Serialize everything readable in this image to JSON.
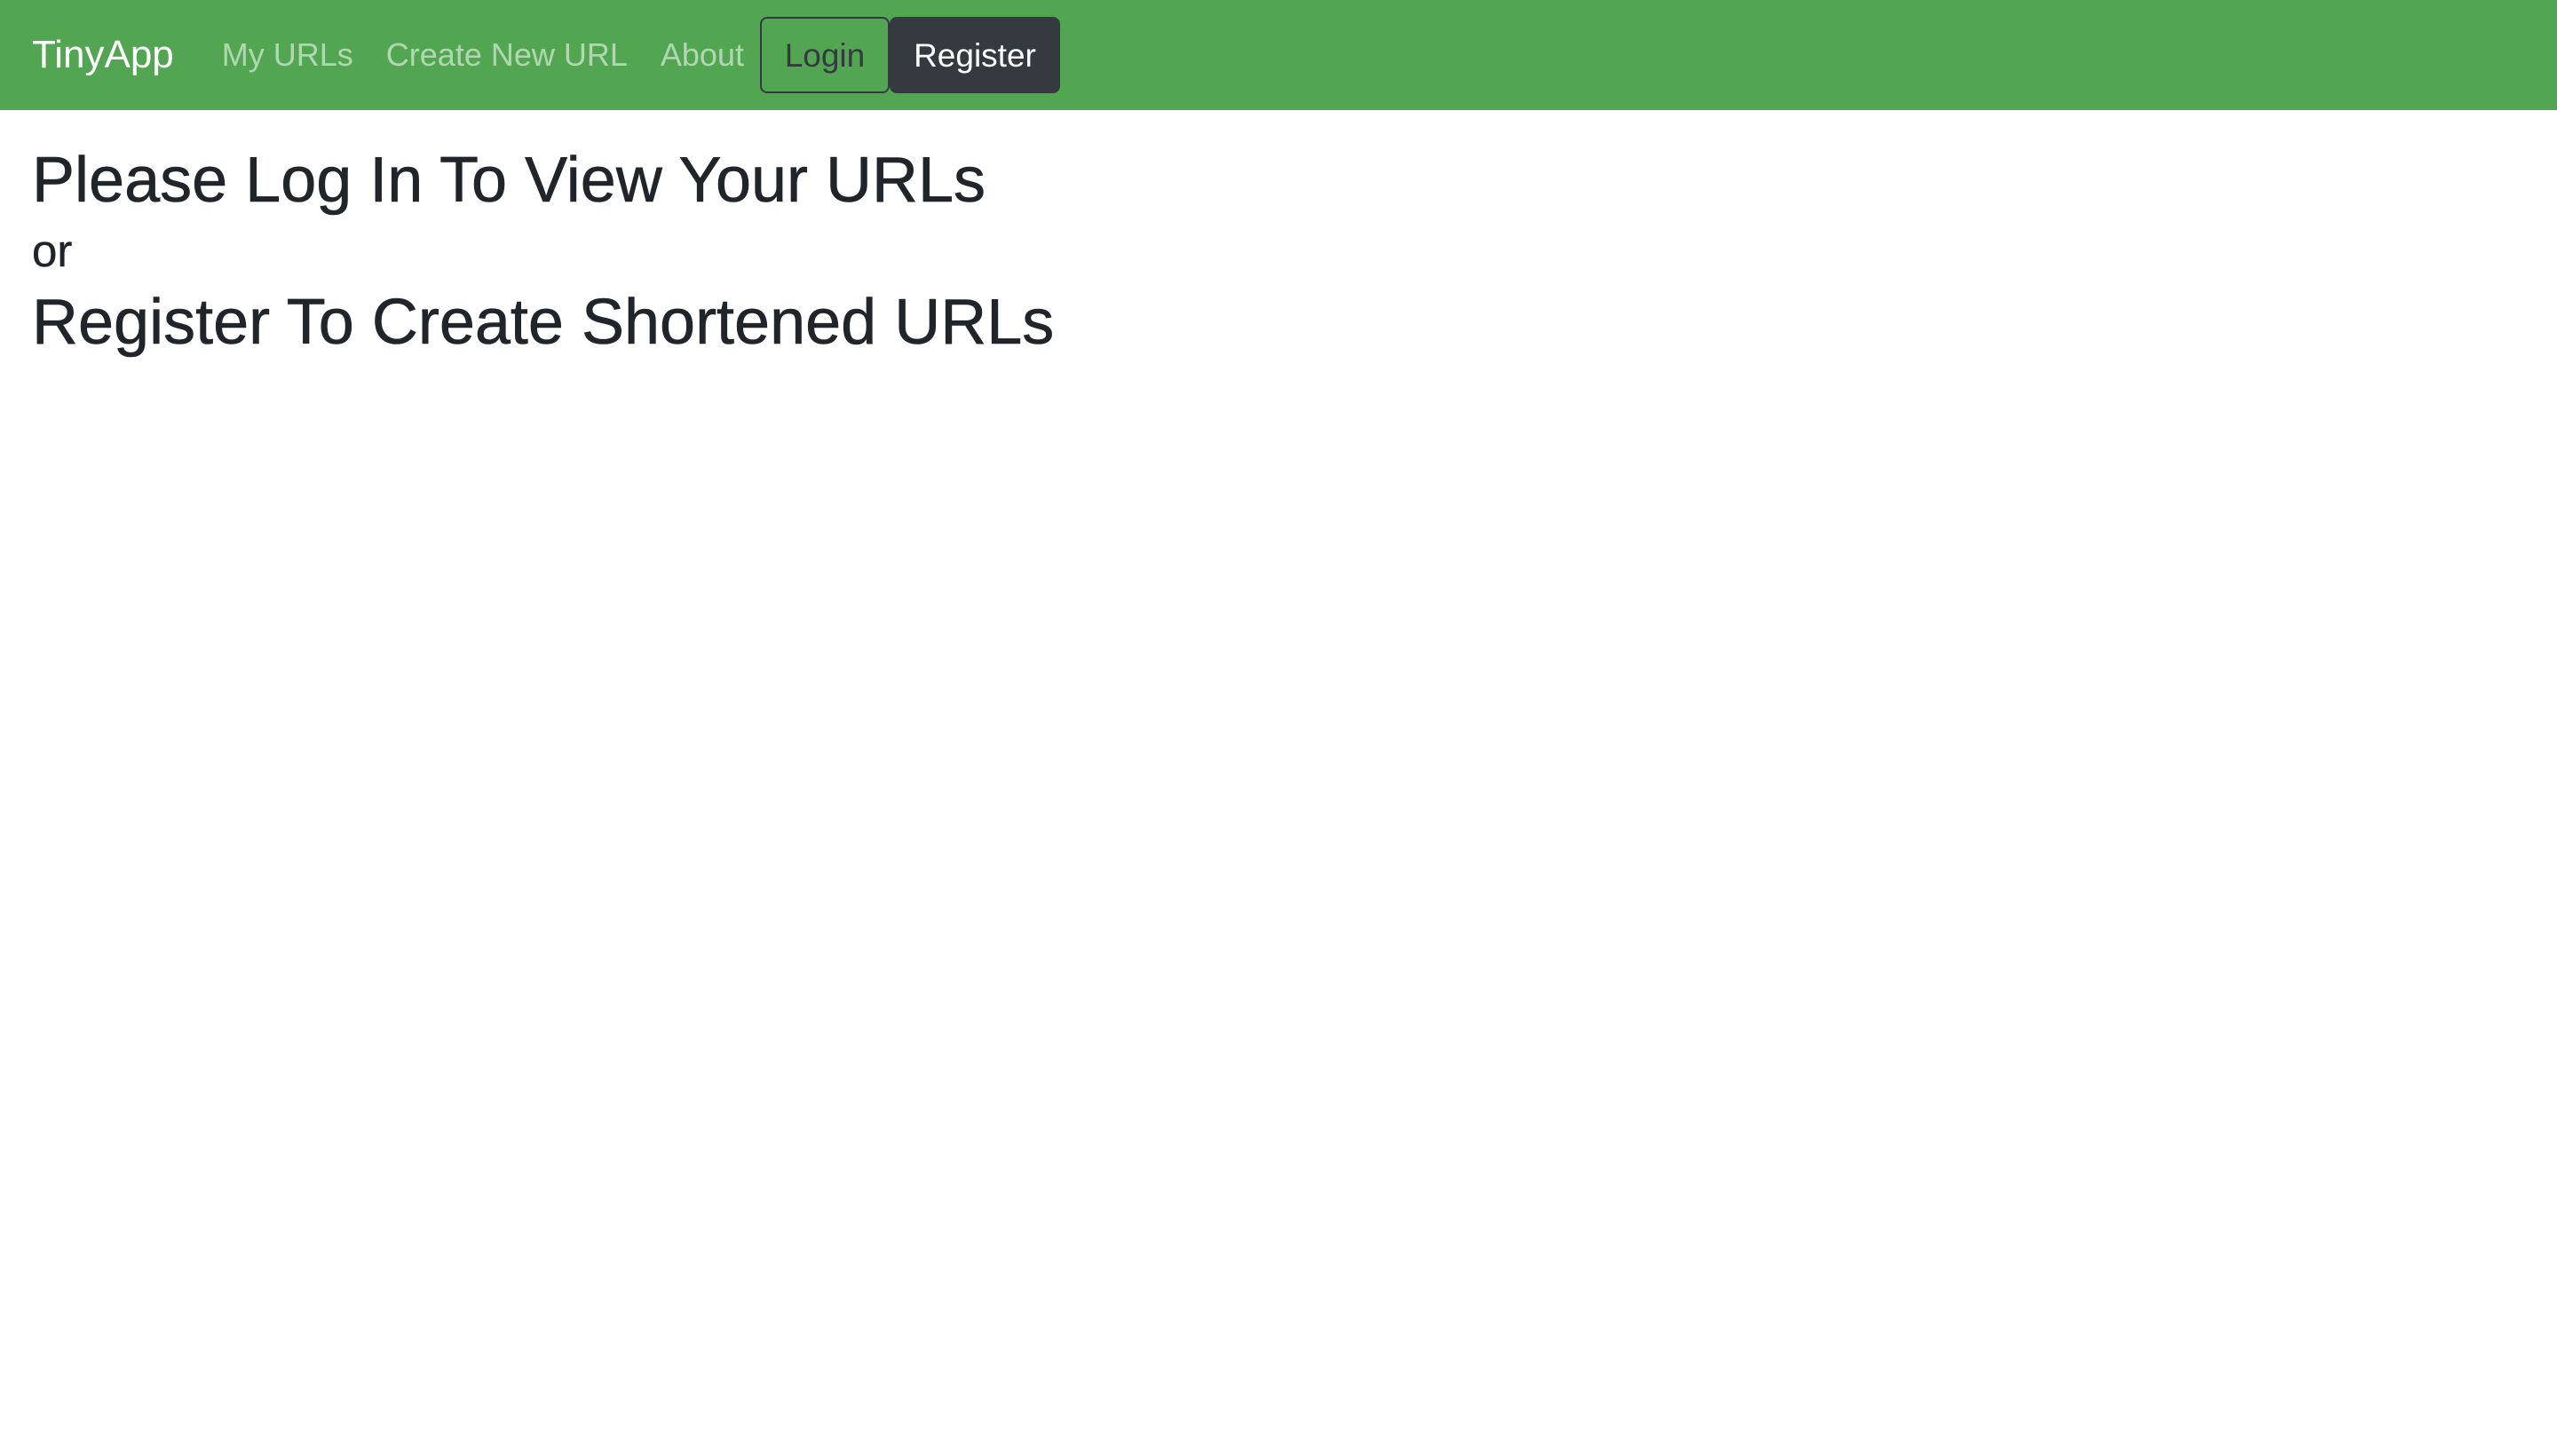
{
  "navbar": {
    "brand": "TinyApp",
    "links": [
      "My URLs",
      "Create New URL",
      "About"
    ],
    "login_label": "Login",
    "register_label": "Register"
  },
  "main": {
    "heading_login": "Please Log In To View Your URLs",
    "or_text": "or",
    "heading_register": "Register To Create Shortened URLs"
  },
  "colors": {
    "navbar_bg": "#52a652",
    "dark_button": "#343a40",
    "text": "#212529"
  }
}
